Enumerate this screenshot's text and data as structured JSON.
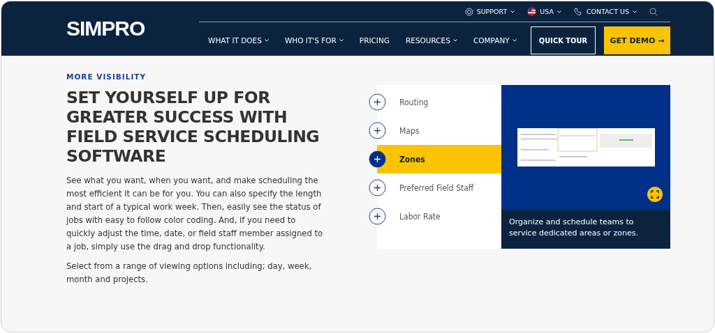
{
  "header": {
    "logo": "SIMPRO",
    "utility": [
      {
        "kind": "support",
        "label": "SUPPORT"
      },
      {
        "kind": "flag",
        "label": "USA"
      },
      {
        "kind": "contact",
        "label": "CONTACT US"
      }
    ],
    "nav": [
      {
        "label": "WHAT IT DOES",
        "dropdown": true
      },
      {
        "label": "WHO IT'S FOR",
        "dropdown": true
      },
      {
        "label": "PRICING",
        "dropdown": false
      },
      {
        "label": "RESOURCES",
        "dropdown": true
      },
      {
        "label": "COMPANY",
        "dropdown": true
      }
    ],
    "quick_tour": "QUICK TOUR",
    "get_demo": "GET DEMO →"
  },
  "section": {
    "eyebrow": "MORE VISIBILITY",
    "heading": "SET YOURSELF UP FOR GREATER SUCCESS WITH FIELD SERVICE SCHEDULING SOFTWARE",
    "paragraphs": [
      "See what you want, when you want, and make scheduling the most efficient it can be for you. You can also specify the length and start of a typical work week. Then, easily see the status of jobs with easy to follow color coding. And, if you need to quickly adjust the time, date, or field staff member assigned to a job, simply use the drag and drop functionality.",
      "Select from a range of viewing options including; day, week, month and projects."
    ]
  },
  "features": [
    {
      "label": "Routing",
      "selected": false
    },
    {
      "label": "Maps",
      "selected": false
    },
    {
      "label": "Zones",
      "selected": true
    },
    {
      "label": "Preferred Field Staff",
      "selected": false
    },
    {
      "label": "Labor Rate",
      "selected": false
    }
  ],
  "preview": {
    "caption": "Organize and schedule teams to service dedicated areas or zones."
  }
}
